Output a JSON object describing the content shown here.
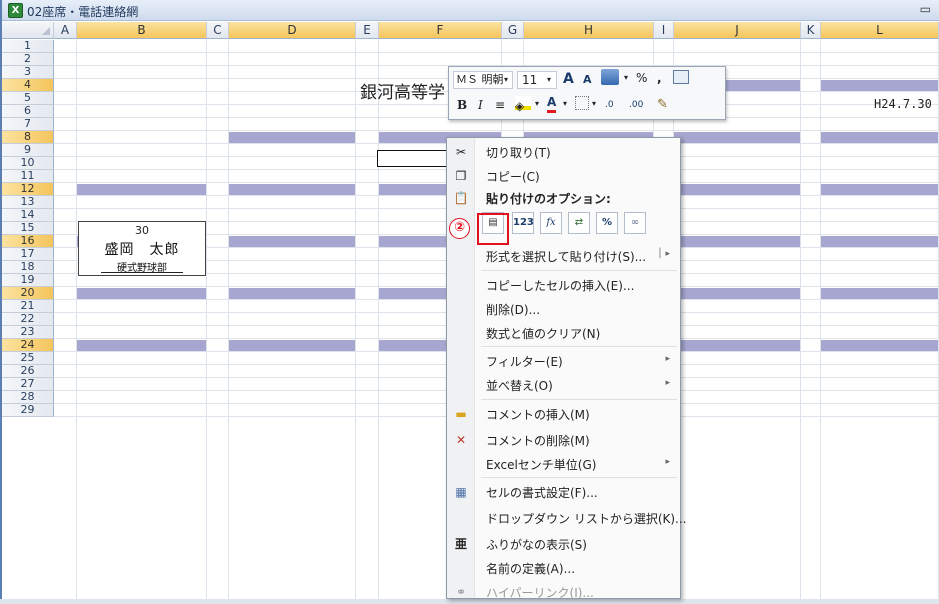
{
  "window": {
    "title": "02座席・電話連絡網",
    "minimize_glyph": "▭"
  },
  "columns": [
    {
      "label": "A",
      "selected": false
    },
    {
      "label": "B",
      "selected": true
    },
    {
      "label": "C",
      "selected": false
    },
    {
      "label": "D",
      "selected": true
    },
    {
      "label": "E",
      "selected": false
    },
    {
      "label": "F",
      "selected": true
    },
    {
      "label": "G",
      "selected": false
    },
    {
      "label": "H",
      "selected": true
    },
    {
      "label": "I",
      "selected": false
    },
    {
      "label": "J",
      "selected": true
    },
    {
      "label": "K",
      "selected": false
    },
    {
      "label": "L",
      "selected": true
    }
  ],
  "rows": [
    {
      "label": "1",
      "selected": false
    },
    {
      "label": "2",
      "selected": false
    },
    {
      "label": "3",
      "selected": false
    },
    {
      "label": "4",
      "selected": true
    },
    {
      "label": "5",
      "selected": false
    },
    {
      "label": "6",
      "selected": false
    },
    {
      "label": "7",
      "selected": false
    },
    {
      "label": "8",
      "selected": true
    },
    {
      "label": "9",
      "selected": false
    },
    {
      "label": "10",
      "selected": false
    },
    {
      "label": "11",
      "selected": false
    },
    {
      "label": "12",
      "selected": true
    },
    {
      "label": "13",
      "selected": false
    },
    {
      "label": "14",
      "selected": false
    },
    {
      "label": "15",
      "selected": false
    },
    {
      "label": "16",
      "selected": true
    },
    {
      "label": "17",
      "selected": false
    },
    {
      "label": "18",
      "selected": false
    },
    {
      "label": "19",
      "selected": false
    },
    {
      "label": "20",
      "selected": true
    },
    {
      "label": "21",
      "selected": false
    },
    {
      "label": "22",
      "selected": false
    },
    {
      "label": "23",
      "selected": false
    },
    {
      "label": "24",
      "selected": true
    },
    {
      "label": "25",
      "selected": false
    },
    {
      "label": "26",
      "selected": false
    },
    {
      "label": "27",
      "selected": false
    },
    {
      "label": "28",
      "selected": false
    },
    {
      "label": "29",
      "selected": false
    }
  ],
  "sheet": {
    "header_title": "銀河高等学",
    "date": "H24.7.30",
    "cell_number": "30",
    "cell_name": "盛岡　太郎",
    "cell_club": "硬式野球部",
    "band_color": "#a6a6d0"
  },
  "mini_toolbar": {
    "font_name": "ＭＳ 明朝",
    "font_size": "11",
    "grow_font": "A",
    "shrink_font": "A",
    "percent": "%",
    "comma": ",",
    "bold": "B",
    "italic": "I",
    "font_color": "A",
    "inc_decimal": ".0",
    "dec_decimal": ".00"
  },
  "context_menu": {
    "cut": "切り取り(T)",
    "copy": "コピー(C)",
    "paste_options": "貼り付けのオプション:",
    "paste_buttons": [
      "",
      "123",
      "fx",
      "⇄",
      "%",
      "∞"
    ],
    "paste_special": "形式を選択して貼り付け(S)...",
    "insert_copied": "コピーしたセルの挿入(E)...",
    "delete": "削除(D)...",
    "clear": "数式と値のクリア(N)",
    "filter": "フィルター(E)",
    "sort": "並べ替え(O)",
    "insert_comment": "コメントの挿入(M)",
    "delete_comment": "コメントの削除(M)",
    "excel_cm": "Excelセンチ単位(G)",
    "format_cells": "セルの書式設定(F)...",
    "dropdown_pick": "ドロップダウン リストから選択(K)...",
    "phonetic": "ふりがなの表示(S)",
    "define_name": "名前の定義(A)...",
    "hyperlink": "ハイパーリンク(I)..."
  },
  "annotation": {
    "badge": "②",
    "color": "#e2101e"
  }
}
